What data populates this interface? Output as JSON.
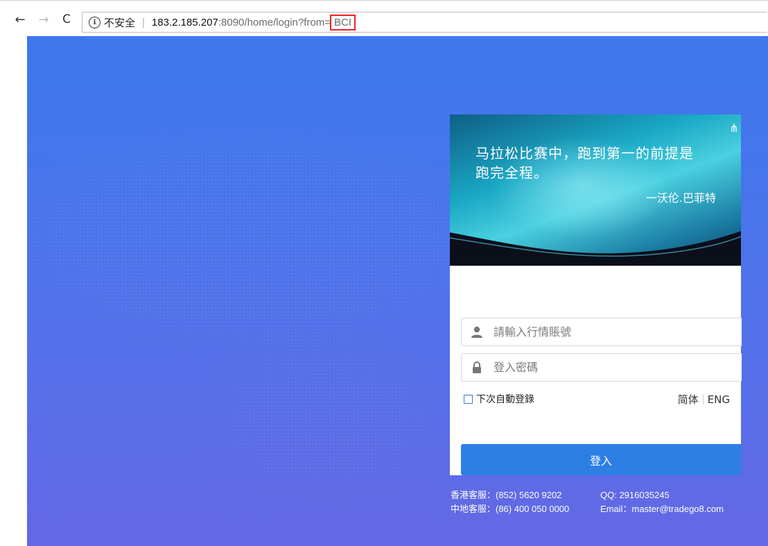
{
  "browser": {
    "insecure_label": "不安全",
    "url_host": "183.2.185.207",
    "url_path": ":8090/home/login?from=",
    "url_highlight": "BCI"
  },
  "banner": {
    "quote_line1": "马拉松比赛中，跑到第一的前提是",
    "quote_line2": "跑完全程。",
    "author": "一沃伦.巴菲特"
  },
  "form": {
    "account_placeholder": "請輸入行情賬號",
    "password_placeholder": "登入密碼",
    "remember_label": "下次自動登錄",
    "lang_simplified": "简体",
    "lang_english": "ENG",
    "login_button": "登入"
  },
  "footer": {
    "hk_service": "香港客服：(852) 5620 9202",
    "qq": "QQ: 2916035245",
    "mainland_service": "中地客服：(86) 400 050 0000",
    "email": "Email：master@tradego8.com"
  },
  "icons": {
    "back": "back-arrow-icon",
    "forward": "forward-arrow-icon",
    "reload": "reload-icon",
    "info": "info-icon",
    "user": "user-icon",
    "lock": "lock-icon",
    "corner": "network-icon"
  },
  "colors": {
    "accent": "#2d7fe4",
    "background_top": "#3e78ec",
    "background_bottom": "#6468e4",
    "highlight_box": "#ee2222"
  }
}
